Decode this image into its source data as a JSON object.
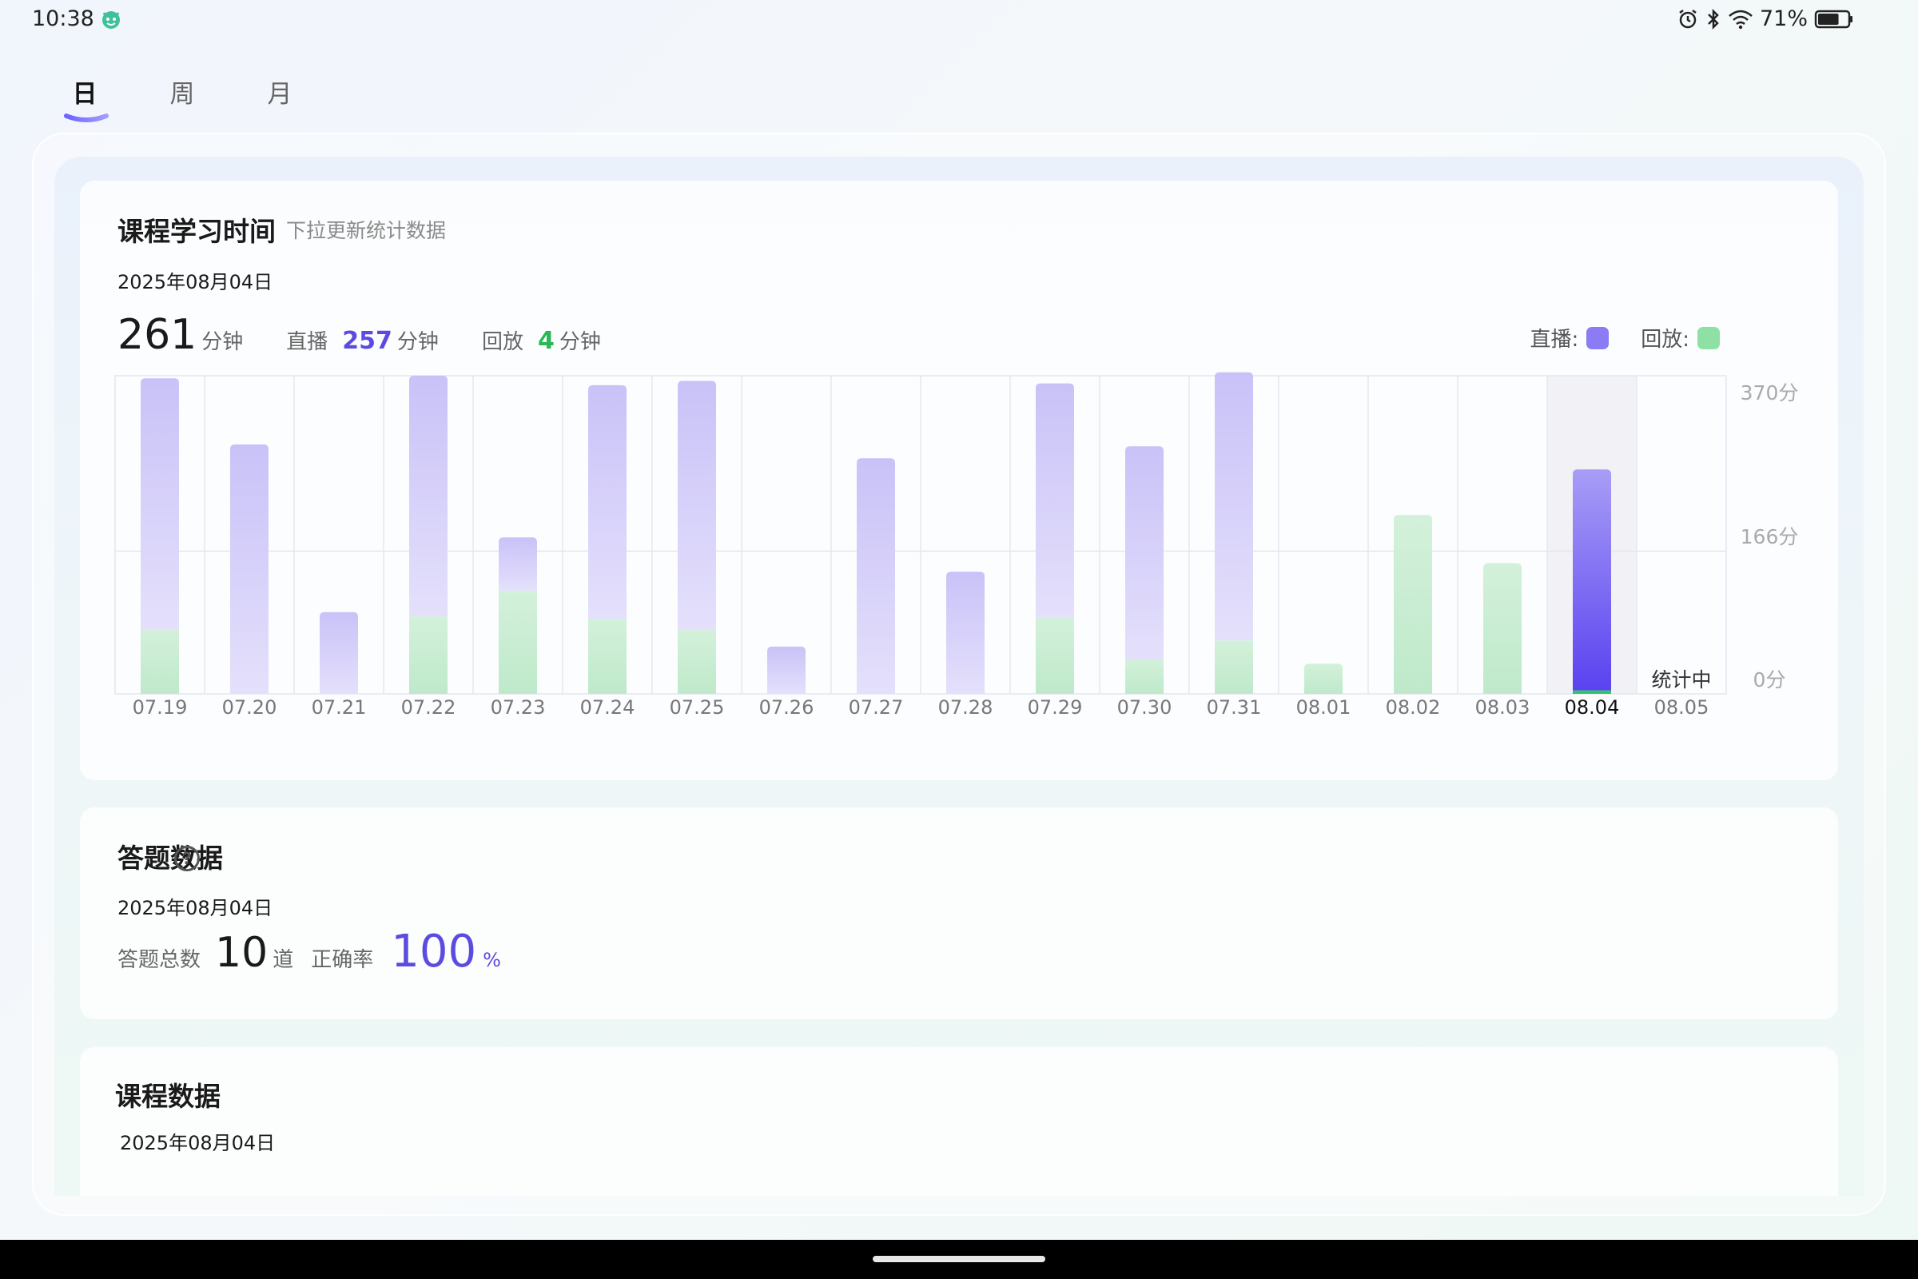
{
  "status_bar": {
    "time": "10:38",
    "app_icon": "smiley-app-icon",
    "icons": [
      "alarm-icon",
      "bluetooth-icon",
      "wifi-icon",
      "battery-icon"
    ],
    "battery": "71%",
    "battery_level": 0.71
  },
  "tabs": [
    {
      "label": "日",
      "active": true
    },
    {
      "label": "周",
      "active": false
    },
    {
      "label": "月",
      "active": false
    }
  ],
  "study_card": {
    "title": "课程学习时间",
    "subtitle": "下拉更新统计数据",
    "date": "2025年08月04日",
    "total_value": "261",
    "total_unit": "分钟",
    "live_label": "直播",
    "live_value": "257",
    "live_unit": "分钟",
    "replay_label": "回放",
    "replay_value": "4",
    "replay_unit": "分钟",
    "legend_live": "直播:",
    "legend_replay": "回放:"
  },
  "answer_card": {
    "title": "答题数据",
    "help_icon": "question-circle-icon",
    "date": "2025年08月04日",
    "total_label": "答题总数",
    "total_value": "10",
    "total_unit": "道",
    "rate_label": "正确率",
    "rate_value": "100",
    "rate_unit": "%"
  },
  "course_card": {
    "title": "课程数据",
    "date": "2025年08月04日"
  },
  "colors": {
    "live": "#8b7bf5",
    "live_selected": "#5a42f0",
    "replay": "#8fe0a4",
    "accent": "#5b4be0",
    "green_text": "#2bb755"
  },
  "chart_data": {
    "type": "bar",
    "stacked": true,
    "categories": [
      "07.19",
      "07.20",
      "07.21",
      "07.22",
      "07.23",
      "07.24",
      "07.25",
      "07.26",
      "07.27",
      "07.28",
      "07.29",
      "07.30",
      "07.31",
      "08.01",
      "08.02",
      "08.03",
      "08.04",
      "08.05"
    ],
    "series": [
      {
        "name": "回放",
        "values": [
          75,
          0,
          0,
          90,
          120,
          87,
          74,
          0,
          0,
          0,
          89,
          40,
          62,
          35,
          208,
          152,
          4,
          0
        ]
      },
      {
        "name": "直播",
        "values": [
          292,
          290,
          95,
          280,
          62,
          272,
          290,
          55,
          274,
          142,
          272,
          248,
          312,
          0,
          0,
          0,
          257,
          0
        ]
      }
    ],
    "y_ticks": [
      "370分",
      "166分",
      "0分"
    ],
    "ylim": [
      0,
      370
    ],
    "selected_category": "08.04",
    "pending_label": "统计中",
    "pending_category": "08.05",
    "grid": true
  }
}
